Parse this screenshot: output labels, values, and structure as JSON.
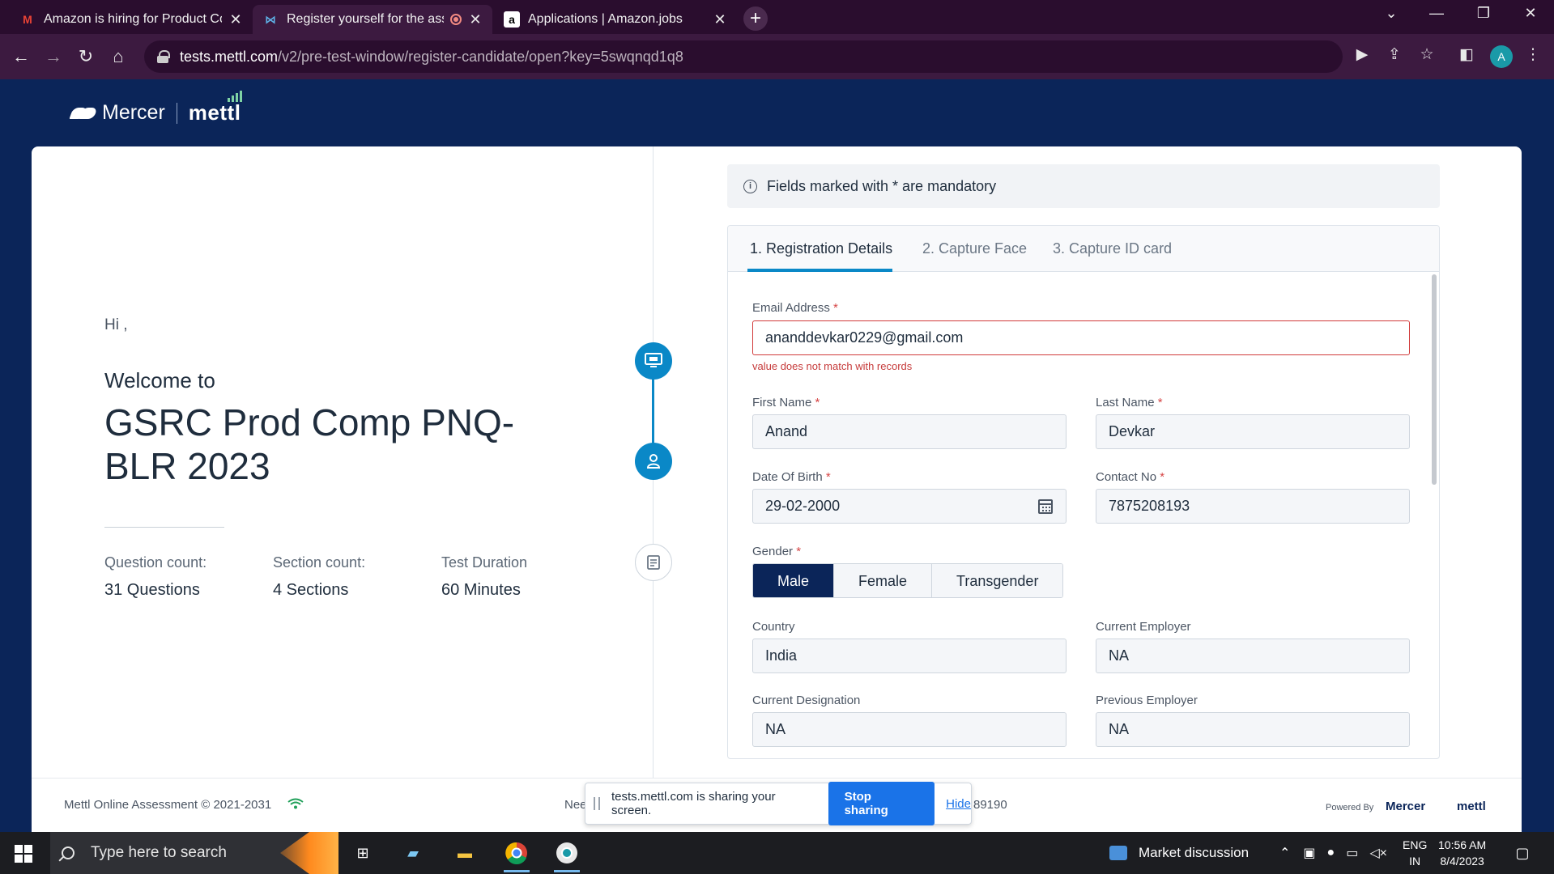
{
  "browser": {
    "tabs": [
      {
        "title": "Amazon is hiring for Product Con",
        "icon": "gmail-icon"
      },
      {
        "title": "Register yourself for the asse",
        "icon": "mettl-icon",
        "recording": true
      },
      {
        "title": "Applications | Amazon.jobs",
        "icon": "amazon-icon"
      }
    ],
    "url_host": "tests.mettl.com",
    "url_path": "/v2/pre-test-window/register-candidate/open?key=5swqnqd1q8",
    "profile_initial": "A"
  },
  "brand": {
    "mercer": "Mercer",
    "mettl": "mettl"
  },
  "left": {
    "greeting": "Hi ,",
    "welcome": "Welcome to",
    "test_name": "GSRC Prod Comp PNQ-BLR 2023",
    "stats": [
      {
        "label": "Question count:",
        "value": "31 Questions"
      },
      {
        "label": "Section count:",
        "value": "4 Sections"
      },
      {
        "label": "Test Duration",
        "value": "60  Minutes"
      }
    ]
  },
  "form": {
    "notice": "Fields marked with * are mandatory",
    "tabs": [
      "1. Registration Details",
      "2. Capture Face",
      "3. Capture ID card"
    ],
    "email": {
      "label": "Email Address",
      "value": "ananddevkar0229@gmail.com",
      "error": "value does not match with records"
    },
    "first_name": {
      "label": "First Name",
      "value": "Anand"
    },
    "last_name": {
      "label": "Last Name",
      "value": "Devkar"
    },
    "dob": {
      "label": "Date Of Birth",
      "value": "29-02-2000"
    },
    "contact": {
      "label": "Contact No",
      "value": "7875208193"
    },
    "gender": {
      "label": "Gender",
      "options": [
        "Male",
        "Female",
        "Transgender"
      ],
      "selected": "Male"
    },
    "country": {
      "label": "Country",
      "value": "India"
    },
    "current_employer": {
      "label": "Current Employer",
      "value": "NA"
    },
    "current_designation": {
      "label": "Current Designation",
      "value": "NA"
    },
    "previous_employer": {
      "label": "Previous Employer",
      "value": "NA"
    },
    "required_mark": "*"
  },
  "footer": {
    "copyright": "Mettl Online Assessment © 2021-2031",
    "need_prefix": "Nee",
    "phone_suffix": "89190",
    "powered_by": "Powered By",
    "pw_mercer": "Mercer",
    "pw_mettl": "mettl"
  },
  "share_bar": {
    "message": "tests.mettl.com is sharing your screen.",
    "stop": "Stop sharing",
    "hide": "Hide"
  },
  "taskbar": {
    "search_placeholder": "Type here to search",
    "news": "Market discussion",
    "lang": "ENG",
    "region": "IN",
    "time": "10:56 AM",
    "date": "8/4/2023"
  },
  "colors": {
    "brand_navy": "#0b2559",
    "accent_blue": "#0a88c7",
    "error_red": "#d13a3a",
    "browser_frame": "#3c1a40"
  }
}
